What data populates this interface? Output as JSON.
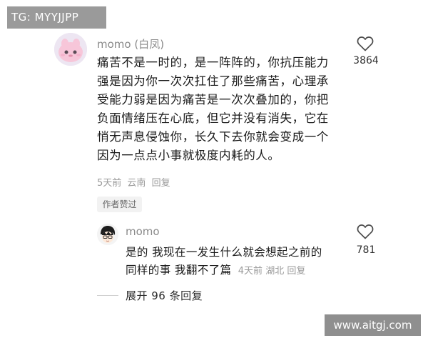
{
  "watermark_top": "TG: MYYJJPP",
  "watermark_bottom": "www.aitgj.com",
  "comment": {
    "username": "momo",
    "username_suffix": "(白凤)",
    "text_lines": [
      "痛苦不是一时的，是一阵阵的，你抗压能力",
      "强是因为你一次次扛住了那些痛苦，心理承",
      "受能力弱是因为痛苦是一次次叠加的，你把",
      "负面情绪压在心底，但它并没有消失，它在",
      "悄无声息侵蚀你，长久下去你就会变成一个",
      "因为一点点小事就极度内耗的人。"
    ],
    "time": "5天前",
    "location": "云南",
    "reply_label": "回复",
    "like_count": "3864",
    "author_liked_badge": "作者赞过"
  },
  "reply": {
    "username": "momo",
    "text_line1": "是的 我现在一发生什么就会想起之前的",
    "text_line2": "同样的事  我翻不了篇",
    "time": "4天前",
    "location": "湖北",
    "reply_label": "回复",
    "like_count": "781"
  },
  "expand_replies": "展开 96 条回复",
  "icons": {
    "like": "heart-outline-icon",
    "avatar_main": "pink-creature-avatar",
    "avatar_reply": "anime-boy-avatar"
  },
  "colors": {
    "text": "#1a1a1a",
    "secondary": "#9a9a9a",
    "badge_bg": "#f2f2f2",
    "watermark_bg": "#9a9a9a"
  }
}
